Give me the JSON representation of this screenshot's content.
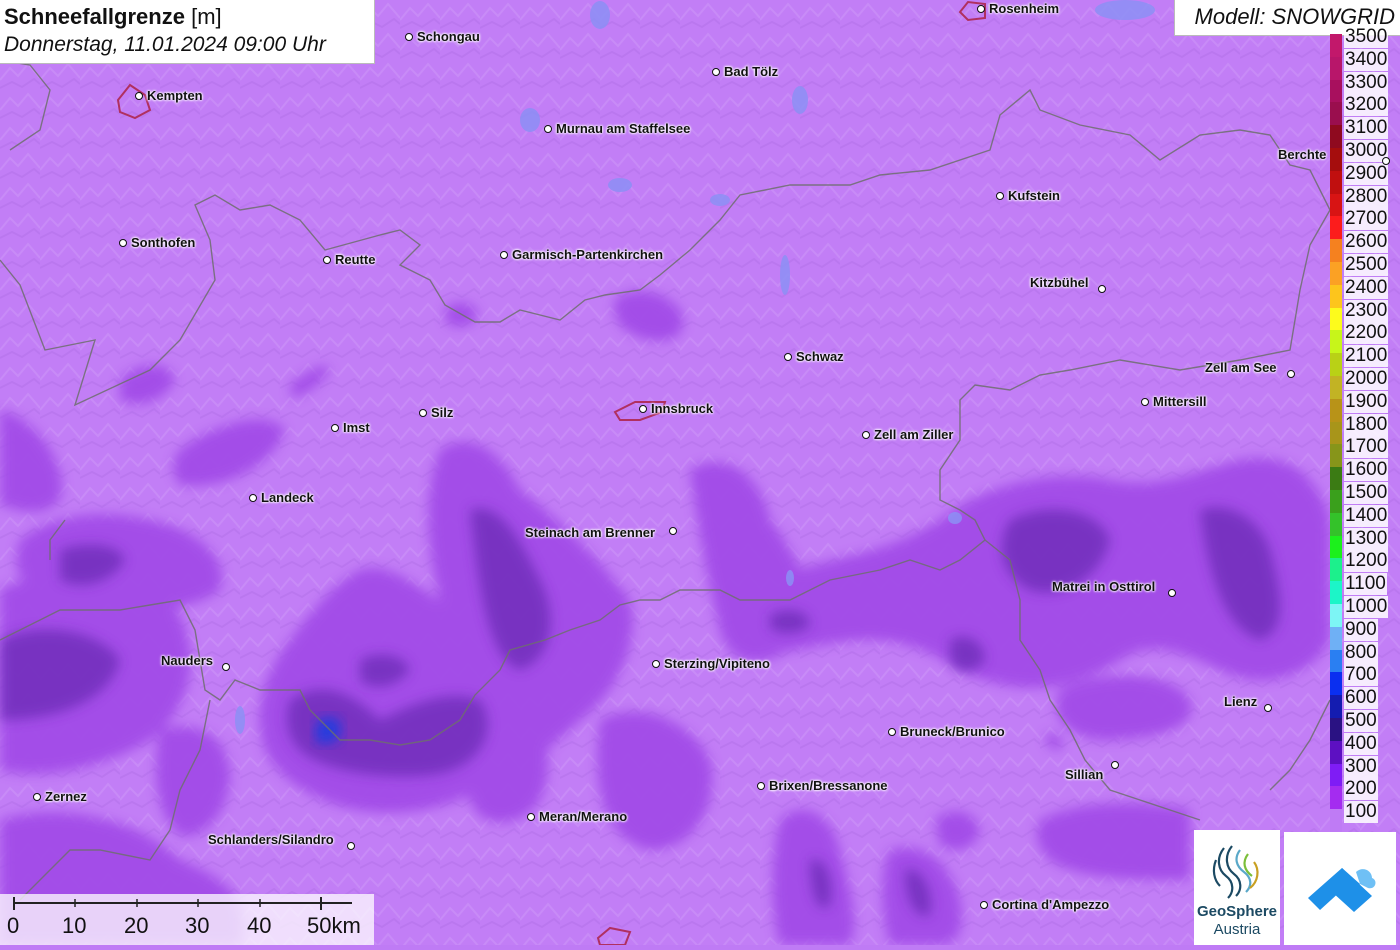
{
  "title": {
    "main": "Schneefallgrenze",
    "unit": "[m]",
    "subtitle": "Donnerstag, 11.01.2024 09:00 Uhr"
  },
  "model_label": "Modell: SNOWGRID",
  "legend": [
    {
      "label": "3500",
      "color": "#c2186b"
    },
    {
      "label": "3400",
      "color": "#b8166a"
    },
    {
      "label": "3300",
      "color": "#a8105e"
    },
    {
      "label": "3200",
      "color": "#9a0e4e"
    },
    {
      "label": "3100",
      "color": "#8f0a1f"
    },
    {
      "label": "3000",
      "color": "#a50d0d"
    },
    {
      "label": "2900",
      "color": "#c00f0f"
    },
    {
      "label": "2800",
      "color": "#d81414"
    },
    {
      "label": "2700",
      "color": "#fc1c1c"
    },
    {
      "label": "2600",
      "color": "#f5811f"
    },
    {
      "label": "2500",
      "color": "#fba124"
    },
    {
      "label": "2400",
      "color": "#fdc51c"
    },
    {
      "label": "2300",
      "color": "#fdfb1c"
    },
    {
      "label": "2200",
      "color": "#c7f51a"
    },
    {
      "label": "2100",
      "color": "#b9d116"
    },
    {
      "label": "2000",
      "color": "#c2b324"
    },
    {
      "label": "1900",
      "color": "#b89318"
    },
    {
      "label": "1800",
      "color": "#a8951a"
    },
    {
      "label": "1700",
      "color": "#87951a"
    },
    {
      "label": "1600",
      "color": "#3b7b14"
    },
    {
      "label": "1500",
      "color": "#3aa01c"
    },
    {
      "label": "1400",
      "color": "#34c22a"
    },
    {
      "label": "1300",
      "color": "#1cf01c"
    },
    {
      "label": "1200",
      "color": "#1cf08c"
    },
    {
      "label": "1100",
      "color": "#1cf5c8"
    },
    {
      "label": "1000",
      "color": "#7df5f5"
    },
    {
      "label": "900",
      "color": "#6fb0f5"
    },
    {
      "label": "800",
      "color": "#2a7ff2"
    },
    {
      "label": "700",
      "color": "#0a2ff0"
    },
    {
      "label": "600",
      "color": "#141cb0"
    },
    {
      "label": "500",
      "color": "#2a1283"
    },
    {
      "label": "400",
      "color": "#5d10c2"
    },
    {
      "label": "300",
      "color": "#7f1cf5"
    },
    {
      "label": "200",
      "color": "#a42cf0"
    },
    {
      "label": "100",
      "color": "#bf7bf5"
    }
  ],
  "cities": [
    {
      "name": "Rosenheim"
    },
    {
      "name": "Schongau"
    },
    {
      "name": "Bad Tölz"
    },
    {
      "name": "Kempten"
    },
    {
      "name": "Murnau am Staffelsee"
    },
    {
      "name": "Berchte"
    },
    {
      "name": "Kufstein"
    },
    {
      "name": "Sonthofen"
    },
    {
      "name": "Reutte"
    },
    {
      "name": "Garmisch-Partenkirchen"
    },
    {
      "name": "Kitzbühel"
    },
    {
      "name": "Schwaz"
    },
    {
      "name": "Zell am See"
    },
    {
      "name": "Mittersill"
    },
    {
      "name": "Innsbruck"
    },
    {
      "name": "Silz"
    },
    {
      "name": "Imst"
    },
    {
      "name": "Zell am Ziller"
    },
    {
      "name": "Landeck"
    },
    {
      "name": "Steinach am Brenner"
    },
    {
      "name": "Matrei in Osttirol"
    },
    {
      "name": "Nauders"
    },
    {
      "name": "Sterzing/Vipiteno"
    },
    {
      "name": "Lienz"
    },
    {
      "name": "Bruneck/Brunico"
    },
    {
      "name": "Sillian"
    },
    {
      "name": "Brixen/Bressanone"
    },
    {
      "name": "Zernez"
    },
    {
      "name": "Meran/Merano"
    },
    {
      "name": "Schlanders/Silandro"
    },
    {
      "name": "Cortina d'Ampezzo"
    }
  ],
  "scale": {
    "labels": [
      "0",
      "10",
      "20",
      "30",
      "40",
      "50km"
    ]
  },
  "logo": {
    "line1": "GeoSphere",
    "line2": "Austria"
  }
}
